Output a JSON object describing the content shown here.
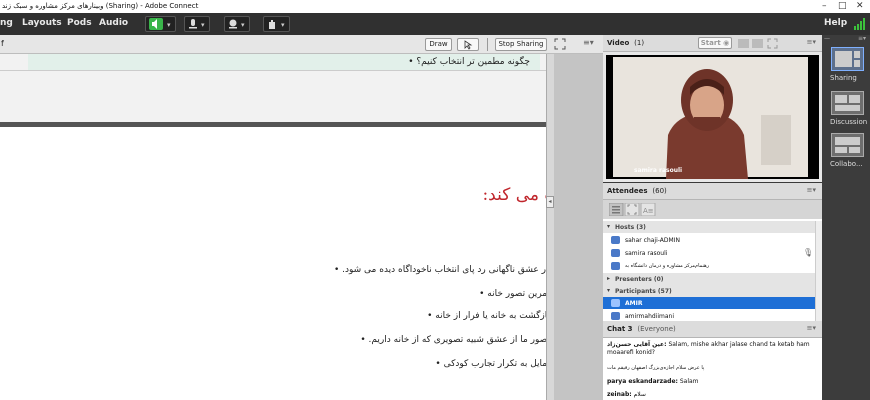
{
  "window": {
    "title": "وبینارهای مرکز مشاوره و سبک زند (Sharing) - Adobe Connect",
    "controls": [
      "–",
      "□",
      "✕"
    ]
  },
  "menu": {
    "items": [
      "ng",
      "Layouts",
      "Pods",
      "Audio"
    ],
    "help": "Help"
  },
  "share_toolbar": {
    "left_fragment": "f",
    "draw_label": "Draw",
    "stop_sharing_label": "Stop Sharing"
  },
  "slides": {
    "upper_bullet": "چگونه مطمین تر انتخاب کنیم؟",
    "title": "مغز ناخوداگاه ما انتخاب می کند:",
    "bullets": [
      "در عشق ناگهانی  رد پای انتخاب ناخوداگاه دیده می شود.",
      "تمرین تصور خانه",
      "بازگشت به خانه یا فرار از خانه",
      "تصور ما از عشق شبیه تصویری که از خانه داریم.",
      "تمایل به تکرار تجارب کودکی"
    ]
  },
  "video": {
    "title": "Video",
    "count": "(1)",
    "start_label": "Start",
    "presenter_name": "samira rasouli"
  },
  "attendees": {
    "title": "Attendees",
    "count": "(60)",
    "hosts_label": "Hosts (3)",
    "hosts": [
      "sahar chaji-ADMIN",
      "samira rasouli",
      "رهنمام‌مرکز مشاوره و درمان دانشگاه به"
    ],
    "presenters_label": "Presenters (0)",
    "participants_label": "Participants (57)",
    "participants": [
      "AMIR",
      "amirmahdiimani"
    ]
  },
  "chat": {
    "title": "Chat 3",
    "audience": "(Everyone)",
    "messages": [
      {
        "sender": "عین آقایی حسن‌زاد:",
        "text": "Salam, mishe akhar jalase chand ta ketab ham moaarefi konid?"
      },
      {
        "sender": "پا عرض سلام  اجازه‌ی‌بزرگ اصفهان رفیقم مات",
        "text": ""
      },
      {
        "sender": "parya eskandarzade:",
        "text": "Salam"
      },
      {
        "sender": "zeinab:",
        "text": "سلام"
      }
    ]
  },
  "layouts": {
    "items": [
      "Sharing",
      "Discussion",
      "Collabo..."
    ]
  },
  "colors": {
    "menubar": "#303030",
    "slide_title": "#c0262c",
    "selected_row": "#1e6fd6",
    "signal": "#3cc13c"
  }
}
